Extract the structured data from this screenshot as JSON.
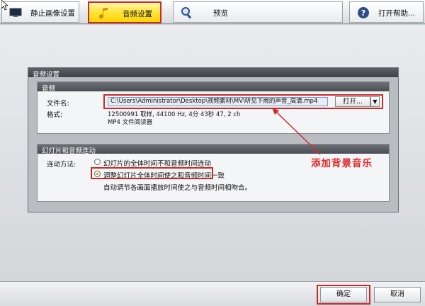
{
  "toolbar": {
    "tabs": [
      {
        "label": "静止画像设置",
        "icon": "monitor-icon",
        "active": false
      },
      {
        "label": "音频设置",
        "icon": "music-note-icon",
        "active": true
      },
      {
        "label": "预览",
        "icon": "magnifier-icon",
        "active": false
      }
    ],
    "help": {
      "label": "打开帮助...",
      "icon": "help-icon"
    }
  },
  "audio_settings": {
    "panel_title": "音频设置",
    "audio_group": {
      "title": "音频",
      "file_label": "文件名:",
      "file_value": "C:\\Users\\Administrator\\Desktop\\视频素材\\MV\\听见下雨的声音_高清.mp4",
      "open_button": "打开...",
      "format_label": "格式:",
      "format_line1": "12500991 取样, 44100 Hz, 4分 43秒 47, 2 ch",
      "format_line2": "MP4 文件阅读器"
    },
    "sync_group": {
      "title": "幻灯片和音频连动",
      "method_label": "连动方法:",
      "options": [
        {
          "label": "幻灯片的全体时间不和音频时间连动",
          "selected": false
        },
        {
          "label": "调整幻灯片全体时间使之和音频时间一致",
          "selected": true
        }
      ],
      "description": "自动调节各画面播放时间使之与音频时间相吻合。"
    }
  },
  "annotation": "添加背景音乐",
  "buttons": {
    "ok": "确定",
    "cancel": "取消"
  },
  "colors": {
    "highlight_red": "#cc2a2a",
    "active_tab": "#ffd400",
    "annotation": "#e0282a"
  }
}
